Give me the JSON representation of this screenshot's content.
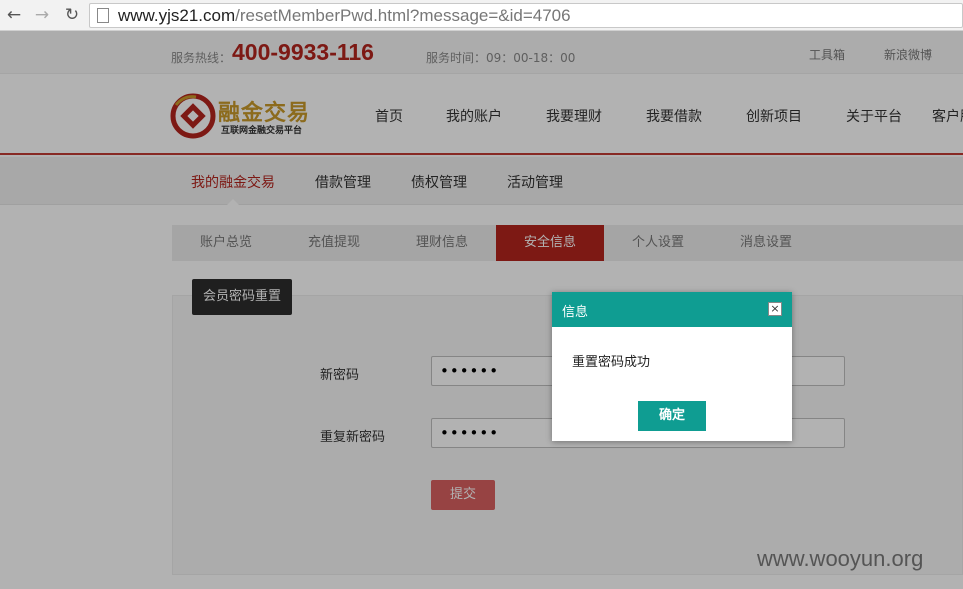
{
  "browser": {
    "url_host": "www.yjs21.com",
    "url_path": "/resetMemberPwd.html?message=&id=4706"
  },
  "topbar": {
    "hotline_label": "服务热线：",
    "hotline_number": "400-9933-116",
    "service_time": "服务时间：09：00-18：00",
    "links": [
      "工具箱",
      "新浪微博"
    ]
  },
  "header": {
    "logo_title": "融金交易",
    "logo_subtitle": "互联网金融交易平台",
    "nav": [
      "首页",
      "我的账户",
      "我要理财",
      "我要借款",
      "创新项目",
      "关于平台",
      "客户服务"
    ]
  },
  "subnav": {
    "items": [
      "我的融金交易",
      "借款管理",
      "债权管理",
      "活动管理"
    ],
    "active_index": 0
  },
  "tabs": {
    "items": [
      "账户总览",
      "充值提现",
      "理财信息",
      "安全信息",
      "个人设置",
      "消息设置"
    ],
    "active_index": 3
  },
  "form": {
    "section_label": "会员密码重置",
    "new_password_label": "新密码",
    "new_password_value": "••••••",
    "repeat_password_label": "重复新密码",
    "repeat_password_value": "••••••",
    "submit_label": "提交"
  },
  "dialog": {
    "title": "信息",
    "message": "重置密码成功",
    "ok_label": "确定"
  },
  "watermark": "www.wooyun.org",
  "colors": {
    "brand_red": "#b3241d",
    "dialog_teal": "#0f9d92",
    "submit_pink": "#d96060"
  }
}
